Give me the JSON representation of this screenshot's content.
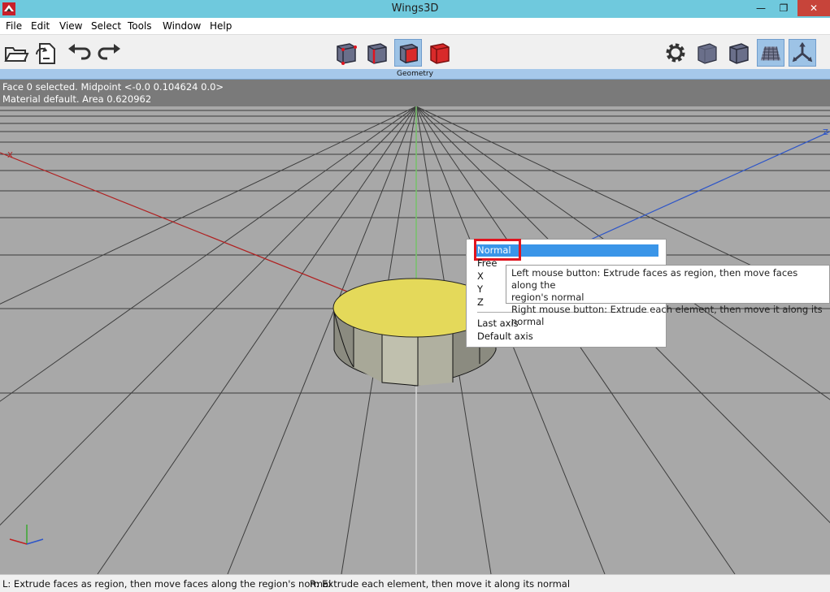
{
  "window": {
    "title": "Wings3D",
    "min": "—",
    "max": "❐",
    "close": "✕"
  },
  "menu": [
    "File",
    "Edit",
    "View",
    "Select",
    "Tools",
    "Window",
    "Help"
  ],
  "toolbar": {
    "left": [
      "open-folder-icon",
      "import-icon",
      "undo-icon",
      "redo-icon"
    ],
    "center": [
      "vertex-mode-icon",
      "edge-mode-icon",
      "face-mode-icon",
      "body-mode-icon"
    ],
    "right": [
      "settings-gear-icon",
      "smooth-shaded-icon",
      "wireframe-icon",
      "ground-grid-icon",
      "axes-icon"
    ],
    "active_mode": "face-mode-icon"
  },
  "geometry_header": "Geometry",
  "info": {
    "line1": "Face 0 selected. Midpoint <-0.0  0.104624  0.0>",
    "line2": "Material default. Area 0.620962"
  },
  "axes": {
    "x": "X",
    "z": "Z"
  },
  "context_menu": {
    "items": [
      "Normal",
      "Free",
      "X",
      "Y",
      "Z"
    ],
    "items_after_separator": [
      "Last axis",
      "Default axis"
    ],
    "selected": "Normal"
  },
  "tooltip": {
    "line1": "Left mouse button: Extrude faces as region, then move faces along the",
    "line2": "region's normal",
    "line3": "Right mouse button: Extrude each element, then move it along its normal"
  },
  "status": {
    "left": "L: Extrude faces as region, then move faces along the region's normal",
    "right": "R: Extrude each element, then move it along its normal"
  },
  "colors": {
    "titlebar": "#6fc9dd",
    "viewport": "#a8a8a8",
    "highlight": "#3a95e8",
    "red_outline": "#e0141e",
    "face_selected": "#e4d95a"
  }
}
